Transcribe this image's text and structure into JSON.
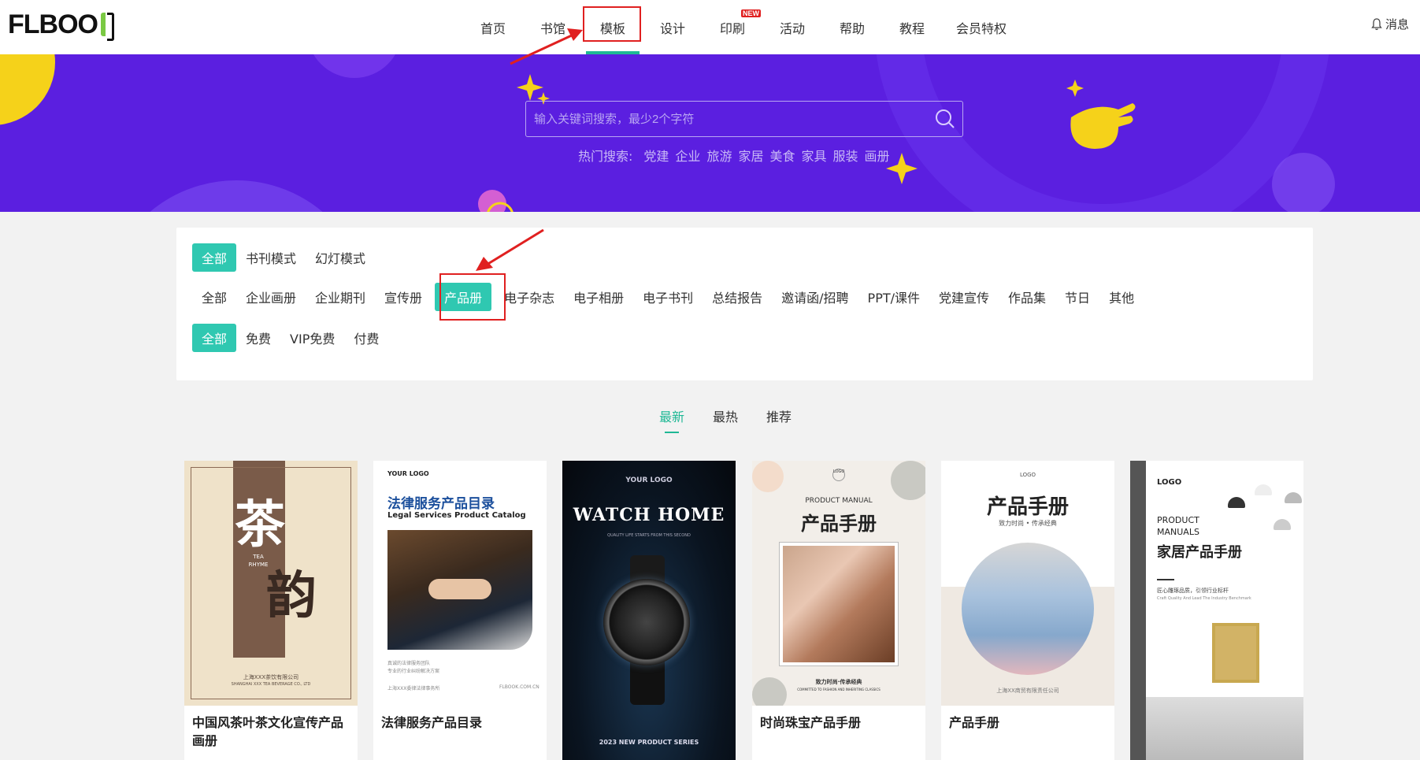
{
  "header": {
    "logo": "FLBOOK",
    "nav": [
      {
        "label": "首页"
      },
      {
        "label": "书馆"
      },
      {
        "label": "模板",
        "active": true
      },
      {
        "label": "设计"
      },
      {
        "label": "印刷",
        "badge": "NEW"
      },
      {
        "label": "活动"
      },
      {
        "label": "帮助"
      },
      {
        "label": "教程"
      },
      {
        "label": "会员特权"
      }
    ],
    "notify_label": "消息"
  },
  "banner": {
    "search_placeholder": "输入关键词搜索，最少2个字符",
    "hot_label": "热门搜索:",
    "hot_tags": [
      "党建",
      "企业",
      "旅游",
      "家居",
      "美食",
      "家具",
      "服装",
      "画册"
    ]
  },
  "filters": {
    "mode": {
      "options": [
        "全部",
        "书刊模式",
        "幻灯模式"
      ],
      "selected": "全部"
    },
    "category": {
      "options": [
        "全部",
        "企业画册",
        "企业期刊",
        "宣传册",
        "产品册",
        "电子杂志",
        "电子相册",
        "电子书刊",
        "总结报告",
        "邀请函/招聘",
        "PPT/课件",
        "党建宣传",
        "作品集",
        "节日",
        "其他"
      ],
      "selected": "产品册"
    },
    "price": {
      "options": [
        "全部",
        "免费",
        "VIP免费",
        "付费"
      ],
      "selected": "全部"
    }
  },
  "sort": {
    "tabs": [
      "最新",
      "最热",
      "推荐"
    ],
    "selected": "最新"
  },
  "cards": [
    {
      "title": "中国风茶叶茶文化宣传产品画册",
      "thumb": {
        "glyph1": "茶",
        "glyph2": "韵",
        "en1": "TEA",
        "en2": "RHYME",
        "company": "上海XXX茶饮有限公司",
        "company_en": "SHANGHAI XXX TEA BEVERAGE CO., LTD"
      }
    },
    {
      "title": "法律服务产品目录",
      "thumb": {
        "logo": "YOUR LOGO",
        "h1": "法律服务产品目录",
        "h2": "Legal Services Product Catalog",
        "foot1": "真诚的法律服务团队",
        "foot2": "专业的行业纠纷解决方案",
        "foot3": "上海XXX委律法律事务所",
        "foot4": "FLBOOK.COM.CN"
      }
    },
    {
      "title": "",
      "thumb": {
        "logo": "YOUR LOGO",
        "h1": "WATCH HOME",
        "h2": "QUALITY LIFE STARTS FROM THIS SECOND",
        "series": "2023 NEW PRODUCT SERIES"
      }
    },
    {
      "title": "时尚珠宝产品手册",
      "thumb": {
        "logo": "LOGO",
        "en": "PRODUCT MANUAL",
        "h1": "产品手册",
        "sub": "致力时尚·传承经典",
        "sub_en": "COMMITTED TO FASHION AND INHERITING CLASSICS"
      }
    },
    {
      "title": "产品手册",
      "thumb": {
        "logo": "LOGO",
        "h1": "产品手册",
        "sub": "致力时尚 • 传承经典",
        "foot": "上海XX商贸有限责任公司"
      }
    },
    {
      "title": "",
      "thumb": {
        "logo": "LOGO",
        "en1": "PRODUCT",
        "en2": "MANUALS",
        "h1": "家居产品手册",
        "sub": "匠心雕琢品质，引领行业标杆",
        "sub_en": "Craft Quality And Lead The Industry Benchmark"
      }
    }
  ],
  "colors": {
    "accent": "#2fc8b1",
    "banner": "#5b1fe0",
    "highlight": "#e02020"
  }
}
